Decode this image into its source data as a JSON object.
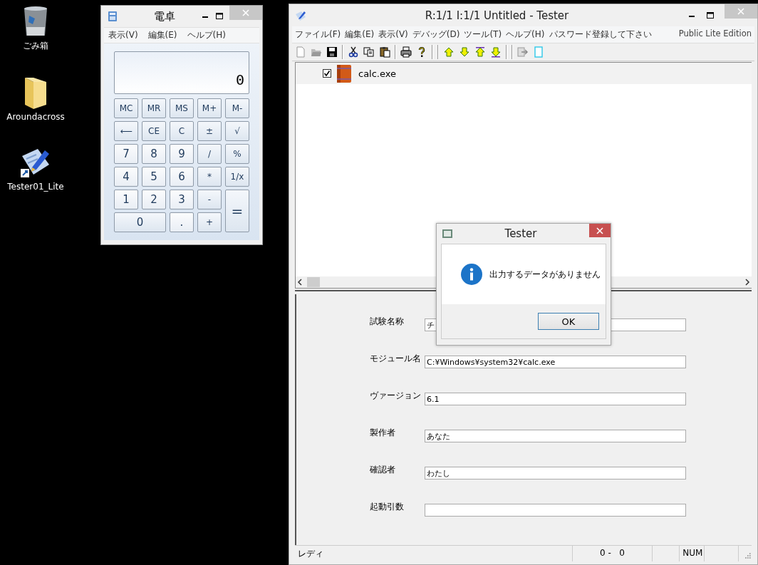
{
  "desktop_icons": [
    {
      "kind": "trash",
      "label": "ごみ箱"
    },
    {
      "kind": "folder",
      "label": "Aroundacross"
    },
    {
      "kind": "app",
      "label": "Tester01_Lite"
    }
  ],
  "calculator": {
    "title": "電卓",
    "menu": [
      "表示(V)",
      "編集(E)",
      "ヘルプ(H)"
    ],
    "display": "0",
    "keys": [
      {
        "label": "MC",
        "kind": "normal"
      },
      {
        "label": "MR",
        "kind": "normal"
      },
      {
        "label": "MS",
        "kind": "normal"
      },
      {
        "label": "M+",
        "kind": "normal"
      },
      {
        "label": "M-",
        "kind": "normal"
      },
      {
        "label": "⟵",
        "kind": "normal"
      },
      {
        "label": "CE",
        "kind": "normal"
      },
      {
        "label": "C",
        "kind": "normal"
      },
      {
        "label": "±",
        "kind": "normal"
      },
      {
        "label": "√",
        "kind": "normal"
      },
      {
        "label": "7",
        "kind": "normal"
      },
      {
        "label": "8",
        "kind": "normal"
      },
      {
        "label": "9",
        "kind": "normal"
      },
      {
        "label": "/",
        "kind": "normal"
      },
      {
        "label": "%",
        "kind": "normal"
      },
      {
        "label": "4",
        "kind": "normal"
      },
      {
        "label": "5",
        "kind": "normal"
      },
      {
        "label": "6",
        "kind": "normal"
      },
      {
        "label": "*",
        "kind": "normal"
      },
      {
        "label": "1/x",
        "kind": "normal"
      },
      {
        "label": "1",
        "kind": "normal"
      },
      {
        "label": "2",
        "kind": "normal"
      },
      {
        "label": "3",
        "kind": "normal"
      },
      {
        "label": "-",
        "kind": "normal"
      },
      {
        "label": "=",
        "kind": "tall"
      },
      {
        "label": "0",
        "kind": "wide"
      },
      {
        "label": ".",
        "kind": "normal"
      },
      {
        "label": "+",
        "kind": "normal"
      }
    ]
  },
  "tester": {
    "title": "R:1/1 I:1/1 Untitled - Tester",
    "menu": [
      "ファイル(F)",
      "編集(E)",
      "表示(V)",
      "デバッグ(D)",
      "ツール(T)",
      "ヘルプ(H)",
      "パスワード登録して下さい"
    ],
    "edition": "Public Lite Edition",
    "tree": [
      {
        "label": "calc.exe",
        "checked": true,
        "selected": true
      }
    ],
    "form": [
      {
        "label": "試験名称",
        "value": "チ"
      },
      {
        "label": "モジュール名",
        "value": "C:¥Windows¥system32¥calc.exe"
      },
      {
        "label": "ヴァージョン",
        "value": "6.1"
      },
      {
        "label": "製作者",
        "value": "あなた"
      },
      {
        "label": "確認者",
        "value": "わたし"
      },
      {
        "label": "起動引数"
      }
    ],
    "status_bar": [
      "レディ",
      "0 -   0",
      "NUM"
    ]
  },
  "dialog": {
    "title": "Tester",
    "message": "出力するデータがありません",
    "button": "OK"
  }
}
